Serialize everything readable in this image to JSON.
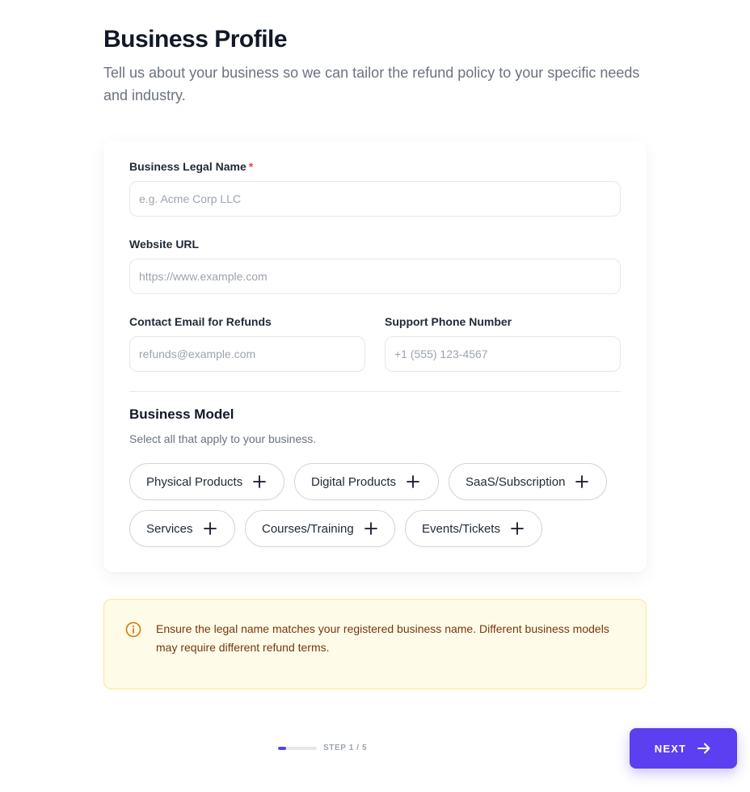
{
  "header": {
    "title": "Business Profile",
    "subtitle": "Tell us about your business so we can tailor the refund policy to your specific needs and industry."
  },
  "form": {
    "legal_name": {
      "label": "Business Legal Name",
      "required_mark": "*",
      "placeholder": "e.g. Acme Corp LLC",
      "value": ""
    },
    "website": {
      "label": "Website URL",
      "placeholder": "https://www.example.com",
      "value": ""
    },
    "email": {
      "label": "Contact Email for Refunds",
      "placeholder": "refunds@example.com",
      "value": ""
    },
    "phone": {
      "label": "Support Phone Number",
      "placeholder": "+1 (555) 123-4567",
      "value": ""
    }
  },
  "business_model": {
    "title": "Business Model",
    "description": "Select all that apply to your business.",
    "options": [
      {
        "label": "Physical Products",
        "icon": "plus-icon"
      },
      {
        "label": "Digital Products",
        "icon": "plus-icon"
      },
      {
        "label": "SaaS/Subscription",
        "icon": "plus-icon"
      },
      {
        "label": "Services",
        "icon": "plus-icon"
      },
      {
        "label": "Courses/Training",
        "icon": "plus-icon"
      },
      {
        "label": "Events/Tickets",
        "icon": "plus-icon"
      }
    ]
  },
  "note": {
    "icon": "info-icon",
    "text": "Ensure the legal name matches your registered business name. Different business models may require different refund terms."
  },
  "footer": {
    "progress_fraction": 0.2,
    "step_text": "STEP 1 / 5",
    "next_label": "NEXT",
    "next_icon": "arrow-right-icon"
  },
  "colors": {
    "accent": "#5b3ff0",
    "progress": "#4f46e5",
    "required": "#ef4444",
    "note_bg": "#fefce8",
    "note_border": "#fde68a",
    "note_text": "#78350f",
    "note_icon": "#d97706"
  }
}
